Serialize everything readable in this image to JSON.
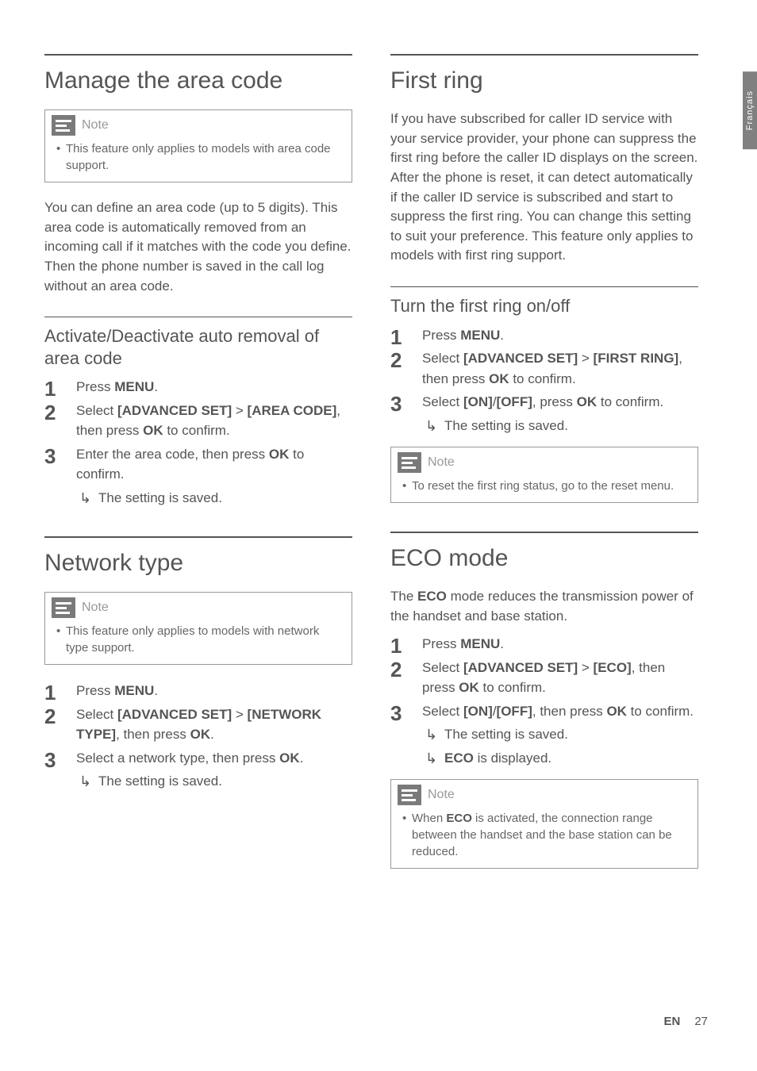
{
  "lang_tab": "Français",
  "footer": {
    "lang": "EN",
    "page": "27"
  },
  "left": {
    "sec1": {
      "heading": "Manage the area code",
      "note_label": "Note",
      "note_items": [
        "This feature only applies to models with area code support."
      ],
      "body": "You can define an area code (up to 5 digits). This area code is automatically removed from an incoming call if it matches with the code you define. Then the phone number is saved in the call log without an area code.",
      "sub_heading": "Activate/Deactivate auto removal of area code",
      "steps": {
        "s1a": "Press ",
        "s1b": "MENU",
        "s1c": ".",
        "s2a": "Select ",
        "s2b": "[ADVANCED SET]",
        "s2c": " > ",
        "s2d": "[AREA CODE]",
        "s2e": ", then press ",
        "s2f": "OK",
        "s2g": " to confirm.",
        "s3a": "Enter the area code, then press ",
        "s3b": "OK",
        "s3c": " to confirm.",
        "s3r": "The setting is saved."
      }
    },
    "sec2": {
      "heading": "Network type",
      "note_label": "Note",
      "note_items": [
        "This feature only applies to models with network type support."
      ],
      "steps": {
        "s1a": "Press ",
        "s1b": "MENU",
        "s1c": ".",
        "s2a": "Select ",
        "s2b": "[ADVANCED SET]",
        "s2c": " > ",
        "s2d": "[NETWORK TYPE]",
        "s2e": ", then press ",
        "s2f": "OK",
        "s2g": ".",
        "s3a": "Select a network type, then press ",
        "s3b": "OK",
        "s3c": ".",
        "s3r": "The setting is saved."
      }
    }
  },
  "right": {
    "sec1": {
      "heading": "First ring",
      "body": "If you have subscribed for caller ID service with your service provider, your phone can suppress the first ring before the caller ID displays on the screen. After the phone is reset, it can detect automatically if the caller ID service is subscribed and start to suppress the first ring. You can change this setting to suit your preference. This feature only applies to models with first ring support.",
      "sub_heading": "Turn the first ring on/off",
      "steps": {
        "s1a": "Press ",
        "s1b": "MENU",
        "s1c": ".",
        "s2a": "Select ",
        "s2b": "[ADVANCED SET]",
        "s2c": " > ",
        "s2d": "[FIRST RING]",
        "s2e": ", then press ",
        "s2f": "OK",
        "s2g": " to confirm.",
        "s3a": "Select ",
        "s3b": "[ON]",
        "s3c": "/",
        "s3d": "[OFF]",
        "s3e": ", press ",
        "s3f": "OK",
        "s3g": " to confirm.",
        "s3r": "The setting is saved."
      },
      "note_label": "Note",
      "note_items": [
        "To reset the first ring status, go to the reset menu."
      ]
    },
    "sec2": {
      "heading": "ECO mode",
      "body_a": "The ",
      "body_b": "ECO",
      "body_c": " mode reduces the transmission power of the handset and base station.",
      "steps": {
        "s1a": "Press ",
        "s1b": "MENU",
        "s1c": ".",
        "s2a": "Select ",
        "s2b": "[ADVANCED SET]",
        "s2c": " > ",
        "s2d": "[ECO]",
        "s2e": ", then press ",
        "s2f": "OK",
        "s2g": " to confirm.",
        "s3a": "Select ",
        "s3b": "[ON]",
        "s3c": "/",
        "s3d": "[OFF]",
        "s3e": ", then press ",
        "s3f": "OK",
        "s3g": " to confirm.",
        "s3r1": "The setting is saved.",
        "s3r2a": "ECO",
        "s3r2b": " is displayed."
      },
      "note_label": "Note",
      "note_a": "When ",
      "note_b": "ECO",
      "note_c": " is activated, the connection range between the handset and the base station can be reduced."
    }
  }
}
